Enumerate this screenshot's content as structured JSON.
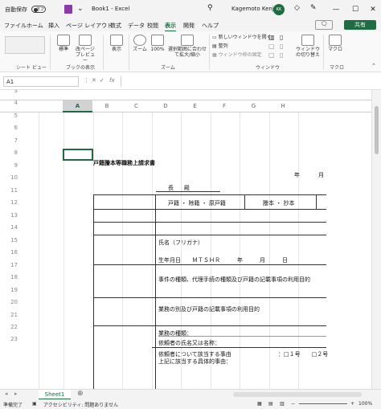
{
  "titlebar": {
    "autosave_label": "自動保存",
    "autosave_state": "オフ",
    "book_title": "Book1 - Excel",
    "user_name": "Kagemoto Kenji",
    "user_initials": "KK"
  },
  "menu": [
    "ファイル",
    "ホーム",
    "挿入",
    "ページ レイアウト",
    "数式",
    "データ",
    "校閲",
    "表示",
    "開発",
    "ヘルプ"
  ],
  "menu_active": "表示",
  "comment_button": "",
  "share_button": "共有",
  "ribbon": {
    "sheet_view_label": "シート ビュー",
    "workbook_view_label": "ブックの表示",
    "standard": "標準",
    "page_preview": "改ページ プレビュー",
    "display": "表示",
    "zoom": "ズーム",
    "zoom_100": "100%",
    "zoom_selection": "選択範囲に合わせて拡大/縮小",
    "zoom_group": "ズーム",
    "new_window": "新しいウィンドウを開く",
    "arrange": "整列",
    "freeze": "ウィンドウ枠の固定",
    "window_group": "ウィンドウ",
    "switch_window": "ウィンドウの切り替え",
    "macro": "マクロ",
    "macro_group": "マクロ"
  },
  "formula": {
    "namebox": "A1",
    "fx": "fx",
    "value": ""
  },
  "columns": [
    "A",
    "B",
    "C",
    "D",
    "E",
    "F",
    "G",
    "H"
  ],
  "rows": [
    "1",
    "2",
    "3",
    "4",
    "5",
    "6",
    "7",
    "8",
    "9",
    "10",
    "11",
    "12",
    "13",
    "14",
    "15",
    "16",
    "17",
    "18",
    "19",
    "20",
    "21",
    "22",
    "23"
  ],
  "document": {
    "title": "戸籍謄本等職務上請求書",
    "year": "年",
    "month": "月",
    "addressee": "長　殿",
    "col_head_1": "戸籍 ・ 除籍 ・ 原戸籍",
    "col_head_2": "謄本 ・ 抄本",
    "name_label": "氏名（フリガナ）",
    "birth_label": "生年月日　　ＭＴＳＨＲ　　　年　　　月　　　日",
    "case_label": "事件の種類、代理手続の種類及び戸籍の記載事項の利用目的",
    "business_label": "業務の別及び戸籍の記載事項の利用目的",
    "business_type": "業務の種類：",
    "client_name": "依頼者の氏名又は名称：",
    "client_reason": "依頼者について該当する事由",
    "reason_option": "：□１号　　□２号",
    "specific_reason": "上記に該当する具体的事由："
  },
  "sheet_tab": "Sheet1",
  "status": {
    "ready": "準備完了",
    "accessibility": "アクセシビリティ: 問題ありません",
    "zoom": "100%"
  }
}
